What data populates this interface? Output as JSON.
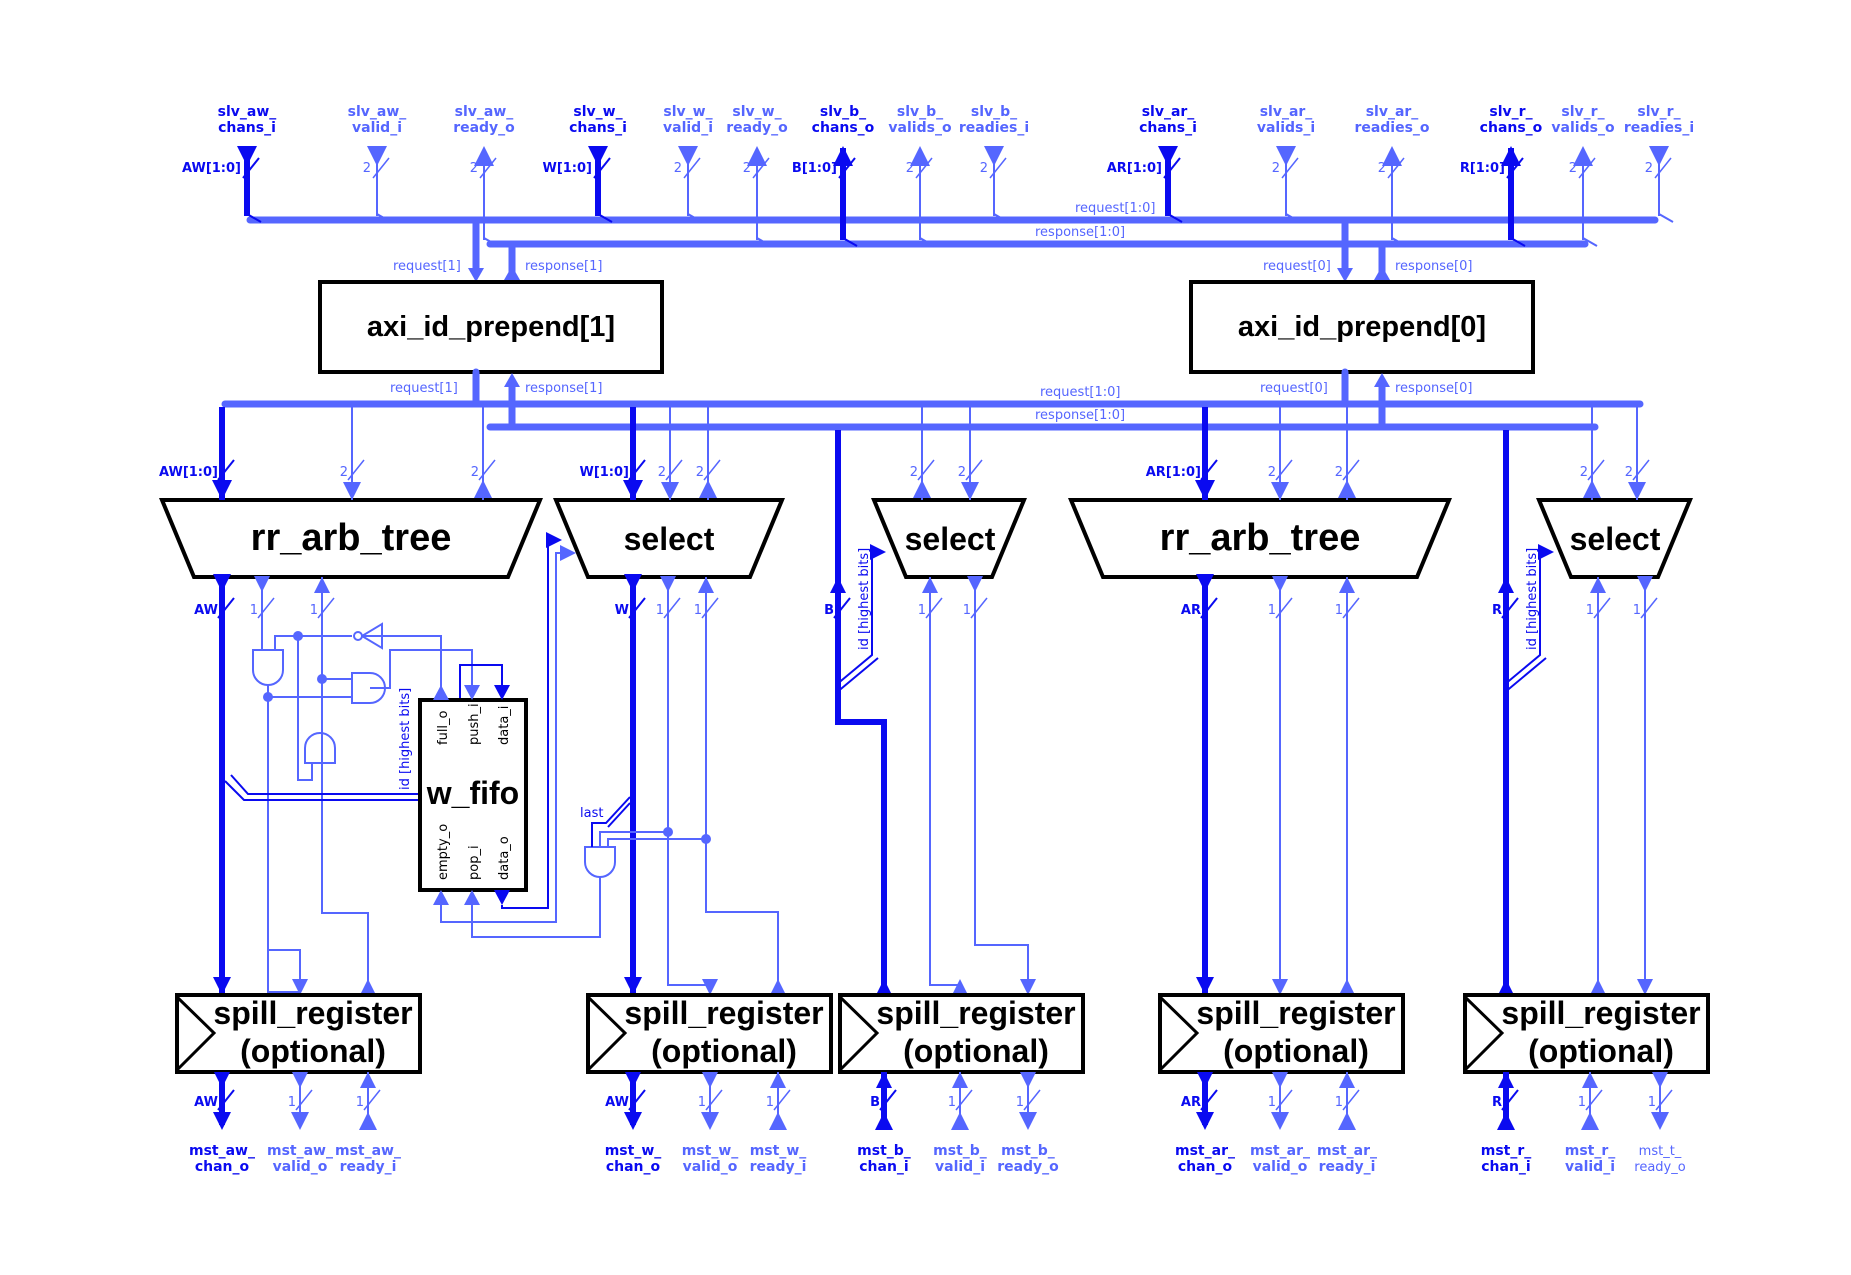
{
  "colors": {
    "channel": "#0a0af0",
    "handshake": "#5566ff",
    "block_outline": "#000000"
  },
  "slave_ports": [
    {
      "name": "slv_aw_chans_i",
      "line1": "slv_aw_",
      "line2": "chans_i",
      "width": "AW[1:0]",
      "kind": "channel",
      "dir": "in"
    },
    {
      "name": "slv_aw_valid_i",
      "line1": "slv_aw_",
      "line2": "valid_i",
      "width": "2",
      "kind": "handshake",
      "dir": "in"
    },
    {
      "name": "slv_aw_ready_o",
      "line1": "slv_aw_",
      "line2": "ready_o",
      "width": "2",
      "kind": "handshake",
      "dir": "out"
    },
    {
      "name": "slv_w_chans_i",
      "line1": "slv_w_",
      "line2": "chans_i",
      "width": "W[1:0]",
      "kind": "channel",
      "dir": "in"
    },
    {
      "name": "slv_w_valid_i",
      "line1": "slv_w_",
      "line2": "valid_i",
      "width": "2",
      "kind": "handshake",
      "dir": "in"
    },
    {
      "name": "slv_w_ready_o",
      "line1": "slv_w_",
      "line2": "ready_o",
      "width": "2",
      "kind": "handshake",
      "dir": "out"
    },
    {
      "name": "slv_b_chans_o",
      "line1": "slv_b_",
      "line2": "chans_o",
      "width": "B[1:0]",
      "kind": "channel",
      "dir": "out"
    },
    {
      "name": "slv_b_valids_o",
      "line1": "slv_b_",
      "line2": "valids_o",
      "width": "2",
      "kind": "handshake",
      "dir": "out"
    },
    {
      "name": "slv_b_readies_i",
      "line1": "slv_b_",
      "line2": "readies_i",
      "width": "2",
      "kind": "handshake",
      "dir": "in"
    },
    {
      "name": "slv_ar_chans_i",
      "line1": "slv_ar_",
      "line2": "chans_i",
      "width": "AR[1:0]",
      "kind": "channel",
      "dir": "in"
    },
    {
      "name": "slv_ar_valids_i",
      "line1": "slv_ar_",
      "line2": "valids_i",
      "width": "2",
      "kind": "handshake",
      "dir": "in"
    },
    {
      "name": "slv_ar_readies_o",
      "line1": "slv_ar_",
      "line2": "readies_o",
      "width": "2",
      "kind": "handshake",
      "dir": "out"
    },
    {
      "name": "slv_r_chans_o",
      "line1": "slv_r_",
      "line2": "chans_o",
      "width": "R[1:0]",
      "kind": "channel",
      "dir": "out"
    },
    {
      "name": "slv_r_valids_o",
      "line1": "slv_r_",
      "line2": "valids_o",
      "width": "2",
      "kind": "handshake",
      "dir": "out"
    },
    {
      "name": "slv_r_readies_i",
      "line1": "slv_r_",
      "line2": "readies_i",
      "width": "2",
      "kind": "handshake",
      "dir": "in"
    }
  ],
  "buses": {
    "top_request": "request[1:0]",
    "top_response": "response[1:0]",
    "mid_request": "request[1:0]",
    "mid_response": "response[1:0]"
  },
  "prepend_blocks": [
    {
      "title": "axi_id_prepend[1]",
      "req_in": "request[1]",
      "resp_in": "response[1]",
      "req_out": "request[1]",
      "resp_out": "response[1]"
    },
    {
      "title": "axi_id_prepend[0]",
      "req_in": "request[0]",
      "resp_in": "response[0]",
      "req_out": "request[0]",
      "resp_out": "response[0]"
    }
  ],
  "mux_blocks": [
    {
      "title": "rr_arb_tree",
      "in_width": "AW[1:0]",
      "out_width": "AW"
    },
    {
      "title": "select",
      "in_width": "W[1:0]",
      "out_width": "W"
    },
    {
      "title": "select",
      "out_width": "B"
    },
    {
      "title": "rr_arb_tree",
      "in_width": "AR[1:0]",
      "out_width": "AR"
    },
    {
      "title": "select",
      "out_width": "R"
    }
  ],
  "handshake_width_in": "2",
  "handshake_width_out": "1",
  "id_note": "id [highest bits]",
  "last_note": "last",
  "fifo": {
    "title": "w_fifo",
    "top_ports": [
      "full_o",
      "push_i",
      "data_i"
    ],
    "bottom_ports": [
      "empty_o",
      "pop_i",
      "data_o"
    ]
  },
  "spill_registers": [
    {
      "line1": "spill_register",
      "line2": "(optional)"
    },
    {
      "line1": "spill_register",
      "line2": "(optional)"
    },
    {
      "line1": "spill_register",
      "line2": "(optional)"
    },
    {
      "line1": "spill_register",
      "line2": "(optional)"
    },
    {
      "line1": "spill_register",
      "line2": "(optional)"
    }
  ],
  "master_ports": [
    {
      "name": "mst_aw_chan_o",
      "line1": "mst_aw_",
      "line2": "chan_o",
      "width": "AW",
      "kind": "channel"
    },
    {
      "name": "mst_aw_valid_o",
      "line1": "mst_aw_",
      "line2": "valid_o",
      "width": "1",
      "kind": "handshake"
    },
    {
      "name": "mst_aw_ready_i",
      "line1": "mst_aw_",
      "line2": "ready_i",
      "width": "1",
      "kind": "handshake"
    },
    {
      "name": "mst_w_chan_o",
      "line1": "mst_w_",
      "line2": "chan_o",
      "width": "AW",
      "kind": "channel"
    },
    {
      "name": "mst_w_valid_o",
      "line1": "mst_w_",
      "line2": "valid_o",
      "width": "1",
      "kind": "handshake"
    },
    {
      "name": "mst_w_ready_i",
      "line1": "mst_w_",
      "line2": "ready_i",
      "width": "1",
      "kind": "handshake"
    },
    {
      "name": "mst_b_chan_i",
      "line1": "mst_b_",
      "line2": "chan_i",
      "width": "B",
      "kind": "channel"
    },
    {
      "name": "mst_b_valid_i",
      "line1": "mst_b_",
      "line2": "valid_i",
      "width": "1",
      "kind": "handshake"
    },
    {
      "name": "mst_b_ready_o",
      "line1": "mst_b_",
      "line2": "ready_o",
      "width": "1",
      "kind": "handshake"
    },
    {
      "name": "mst_ar_chan_o",
      "line1": "mst_ar_",
      "line2": "chan_o",
      "width": "AR",
      "kind": "channel"
    },
    {
      "name": "mst_ar_valid_o",
      "line1": "mst_ar_",
      "line2": "valid_o",
      "width": "1",
      "kind": "handshake"
    },
    {
      "name": "mst_ar_ready_i",
      "line1": "mst_ar_",
      "line2": "ready_i",
      "width": "1",
      "kind": "handshake"
    },
    {
      "name": "mst_r_chan_i",
      "line1": "mst_r_",
      "line2": "chan_i",
      "width": "R",
      "kind": "channel"
    },
    {
      "name": "mst_r_valid_i",
      "line1": "mst_r_",
      "line2": "valid_i",
      "width": "1",
      "kind": "handshake"
    },
    {
      "name": "mst_t_ready_o",
      "line1": "mst_t_",
      "line2": "ready_o",
      "width": "1",
      "kind": "handshake"
    }
  ]
}
